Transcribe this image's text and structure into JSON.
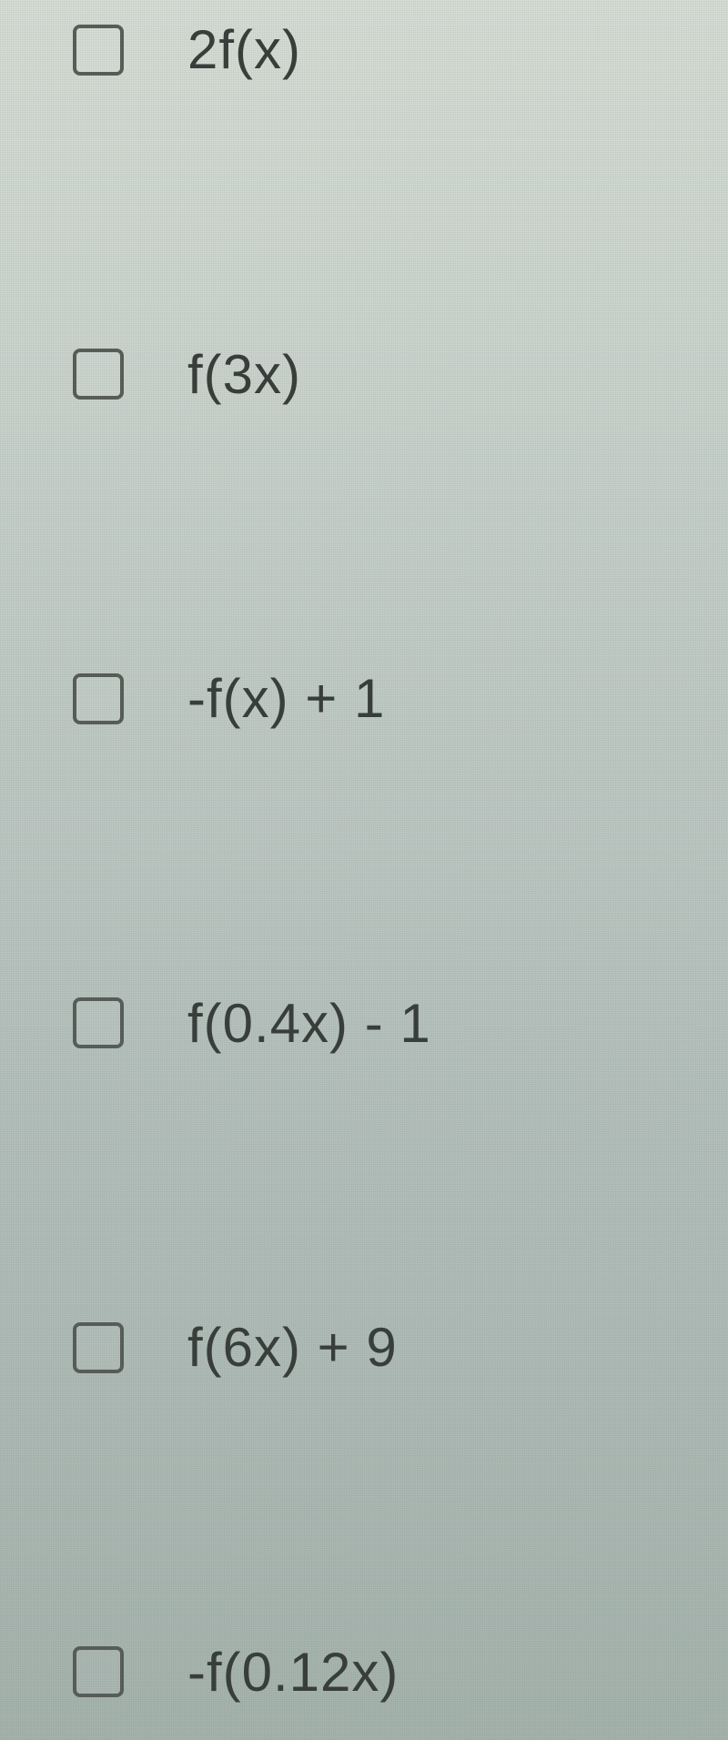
{
  "options": [
    {
      "label": "2f(x)"
    },
    {
      "label": "f(3x)"
    },
    {
      "label": "-f(x) + 1"
    },
    {
      "label": "f(0.4x) - 1"
    },
    {
      "label": "f(6x) + 9"
    },
    {
      "label": "-f(0.12x)"
    }
  ]
}
